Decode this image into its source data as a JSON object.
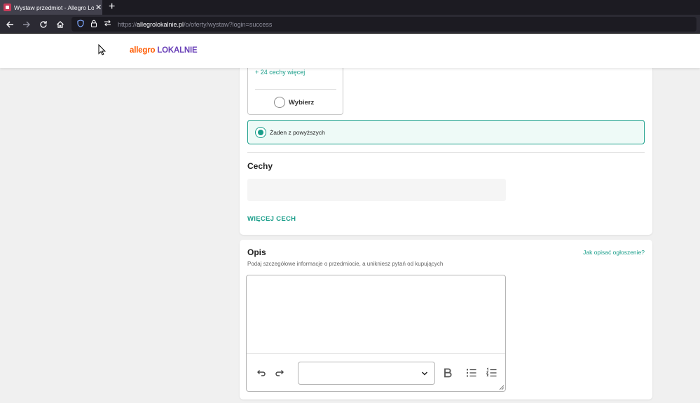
{
  "browser": {
    "tab_title": "Wystaw przedmiot - Allegro Lokalnie",
    "close_glyph": "✕",
    "new_tab_glyph": "+",
    "url_prefix": "https://",
    "url_host": "allegrolokalnie.pl",
    "url_path": "/o/oferty/wystaw?login=success"
  },
  "header": {
    "logo_part1": "allegro",
    "logo_part2": "LOKALNIE",
    "logo_colors": {
      "allegro": "#ff5a00",
      "lokalnie": "#6a41b8"
    }
  },
  "features": {
    "more_features_link": "+ 24 cechy więcej",
    "choose_label": "Wybierz",
    "none_option_label": "Żaden z powyższych",
    "section_title": "Cechy",
    "more_features_button": "WIĘCEJ CECH"
  },
  "description": {
    "title": "Opis",
    "help_link": "Jak opisać ogłoszenie?",
    "subtitle": "Podaj szczegółowe informacje o przedmiocie, a unikniesz pytań od kupujących",
    "text_value": "",
    "style_select_value": ""
  },
  "icons": {
    "back": "arrow-left-icon",
    "forward": "arrow-right-icon",
    "reload": "reload-icon",
    "home": "home-icon",
    "shield": "shield-icon",
    "lock": "lock-icon",
    "permissions": "permissions-icon",
    "undo": "undo-icon",
    "redo": "redo-icon",
    "bold": "bold-icon",
    "bullet_list": "bullet-list-icon",
    "numbered_list": "numbered-list-icon",
    "chevron": "chevron-down-icon"
  },
  "colors": {
    "accent": "#1a9e8a",
    "accent_bg": "#eefaf7"
  }
}
